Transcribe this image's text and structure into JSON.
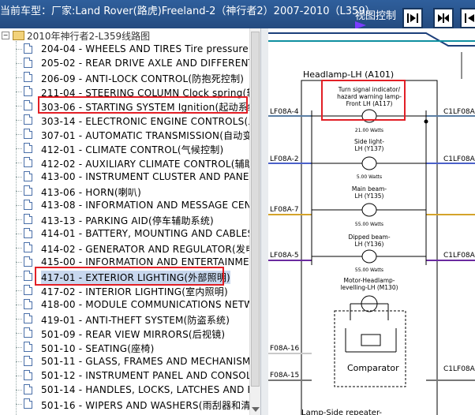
{
  "header": {
    "title": "当前车型：厂家:Land Rover(路虎)Freeland-2（神行者2）2007-2010（L359）",
    "view_control": "视图控制"
  },
  "tree": {
    "root_label": "2010年神行者2-L359线路图",
    "items": [
      {
        "label": "204-04 - WHEELS AND TIRES Tire pressure m"
      },
      {
        "label": "205-02 - REAR DRIVE AXLE AND DIFFERENTI"
      },
      {
        "label": "206-09 - ANTI-LOCK CONTROL(防抱死控制)"
      },
      {
        "label": "211-04 - STEERING COLUMN Clock spring(转向"
      },
      {
        "label": "303-06 - STARTING SYSTEM Ignition(起动系统"
      },
      {
        "label": "303-14 - ELECTRONIC ENGINE CONTROLS(发"
      },
      {
        "label": "307-01 - AUTOMATIC TRANSMISSION(自动变速"
      },
      {
        "label": "412-01 - CLIMATE CONTROL(气候控制)"
      },
      {
        "label": "412-02 - AUXILIARY CLIMATE CONTROL(辅助气"
      },
      {
        "label": "413-00 - INSTRUMENT CLUSTER AND PANEL I"
      },
      {
        "label": "413-06 - HORN(喇叭)"
      },
      {
        "label": "413-08 - INFORMATION AND MESSAGE CENTI"
      },
      {
        "label": "413-13 - PARKING AID(停车辅助系统)"
      },
      {
        "label": "414-01 - BATTERY, MOUNTING AND CABLES("
      },
      {
        "label": "414-02 - GENERATOR AND REGULATOR(发电机"
      },
      {
        "label": "415-00 - INFORMATION AND ENTERTAINMENT"
      },
      {
        "label": "417-01 - EXTERIOR LIGHTING(外部照明)"
      },
      {
        "label": "417-02 - INTERIOR LIGHTING(室内照明)"
      },
      {
        "label": "418-00 - MODULE COMMUNICATIONS NETWO"
      },
      {
        "label": "419-01 - ANTI-THEFT SYSTEM(防盗系统)"
      },
      {
        "label": "501-09 - REAR VIEW MIRRORS(后视镜)"
      },
      {
        "label": "501-10 - SEATING(座椅)"
      },
      {
        "label": "501-11 - GLASS, FRAMES AND MECHANISMS("
      },
      {
        "label": "501-12 - INSTRUMENT PANEL AND CONSOLE("
      },
      {
        "label": "501-14 - HANDLES, LOCKS, LATCHES AND EN"
      },
      {
        "label": "501-16 - WIPERS AND WASHERS(雨刮器和清洗"
      }
    ]
  },
  "diagram": {
    "box_title": "Headlamp-LH (A101)",
    "lamps": [
      {
        "name_line1": "Turn signal indicator/",
        "name_line2": "hazard warning lamp-",
        "name_line3": "Front LH (A117)",
        "watts": "21.00 Watts"
      },
      {
        "name_line1": "Side light-",
        "name_line2": "LH (Y137)",
        "watts": "5.00 Watts"
      },
      {
        "name_line1": "Main beam-",
        "name_line2": "LH (Y135)",
        "watts": "55.00 Watts"
      },
      {
        "name_line1": "Dipped beam-",
        "name_line2": "LH (Y136)",
        "watts": "55.00 Watts"
      }
    ],
    "motor": {
      "line1": "Motor-Headlamp-",
      "line2": "levelling-LH (M130)"
    },
    "comparator": "Comparator",
    "left_pins": [
      "LF08A-4",
      "LF08A-2",
      "LF08A-7",
      "LF08A-5",
      "F08A-16",
      "F08A-15"
    ],
    "right_pins": [
      "C1LF08A",
      "C1LF08A",
      "C1LF08A",
      "C1LF08A"
    ],
    "bottom_label": "Lamp-Side repeater-"
  }
}
